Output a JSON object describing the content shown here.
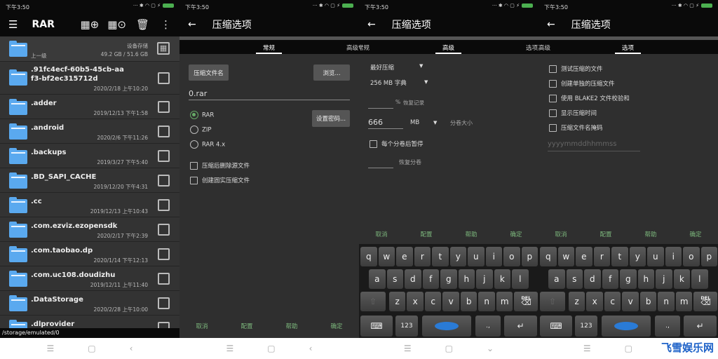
{
  "status": {
    "time": "下午3:50",
    "icons": [
      "dots-icon",
      "bluetooth-icon",
      "wifi-icon",
      "sim-icon",
      "charge-icon",
      "battery-icon"
    ]
  },
  "colors": {
    "accent": "#4caf50",
    "folder": "#5aa9ef",
    "footer_text": "#7cb77c"
  },
  "browser": {
    "title": "RAR",
    "toolbar_icons": [
      "add-to-archive-icon",
      "extract-icon",
      "trash-icon",
      "more-icon"
    ],
    "parent": {
      "label": "上一级",
      "storage_name": "设备存储",
      "storage_size": "49.2 GB / 51.6 GB"
    },
    "items": [
      {
        "name": ".91fc4ecf-60b5-45cb-aaf3-bf2ec315712d",
        "date": "2020/2/18 上午10:20"
      },
      {
        "name": ".adder",
        "date": "2019/12/13 下午1:58"
      },
      {
        "name": ".android",
        "date": "2020/2/6 下午11:26"
      },
      {
        "name": ".backups",
        "date": "2019/3/27 下午5:40"
      },
      {
        "name": ".BD_SAPI_CACHE",
        "date": "2019/12/20 下午4:31"
      },
      {
        "name": ".cc",
        "date": "2019/12/13 上午10:43"
      },
      {
        "name": ".com.ezviz.ezopensdk",
        "date": "2020/2/17 下午2:39"
      },
      {
        "name": ".com.taobao.dp",
        "date": "2020/1/14 下午12:13"
      },
      {
        "name": ".com.uc108.doudizhu",
        "date": "2019/12/11 上午11:40"
      },
      {
        "name": ".DataStorage",
        "date": "2020/2/28 上午10:00"
      },
      {
        "name": ".dlprovider",
        "date": ""
      }
    ],
    "path": "/storage/emulated/0"
  },
  "options": {
    "title": "压缩选项",
    "footer": [
      "取消",
      "配置",
      "帮助",
      "确定"
    ],
    "general": {
      "tabs": [
        "常规",
        "高级常规"
      ],
      "archive_name_button": "压缩文件名",
      "browse_button": "浏览...",
      "archive_name": "0.rar",
      "password_button": "设置密码...",
      "formats": [
        {
          "label": "RAR",
          "selected": true
        },
        {
          "label": "ZIP",
          "selected": false
        },
        {
          "label": "RAR 4.x",
          "selected": false
        }
      ],
      "checks": [
        {
          "label": "压缩后删除源文件",
          "checked": false
        },
        {
          "label": "创建固实压缩文件",
          "checked": false
        }
      ]
    },
    "advanced": {
      "tabs": [
        "常规",
        "高级",
        "选项高级"
      ],
      "method": "最好压缩",
      "dictionary": "256 MB 字典",
      "recovery_unit": "%",
      "recovery_label": "恢复记录",
      "recovery_value": "",
      "volume_value": "666",
      "volume_unit": "MB",
      "volume_label": "分卷大小",
      "pause_label": "每个分卷后暂停",
      "pause_checked": false,
      "recover_volumes_label": "恢复分卷"
    },
    "extra": {
      "tabs": [
        "高级",
        "选项"
      ],
      "checks": [
        {
          "label": "测试压缩的文件",
          "checked": false
        },
        {
          "label": "创建单独的压缩文件",
          "checked": false
        },
        {
          "label": "使用 BLAKE2 文件校验和",
          "checked": false
        },
        {
          "label": "显示压缩时间",
          "checked": false
        },
        {
          "label": "压缩文件名掩码",
          "checked": false
        }
      ],
      "mask_placeholder": "yyyymmddhhmmss"
    }
  },
  "keyboard": {
    "rows": [
      [
        "q",
        "w",
        "e",
        "r",
        "t",
        "y",
        "u",
        "i",
        "o",
        "p"
      ],
      [
        "a",
        "s",
        "d",
        "f",
        "g",
        "h",
        "j",
        "k",
        "l"
      ],
      [
        "shift",
        "z",
        "x",
        "c",
        "v",
        "b",
        "n",
        "m",
        "DEL"
      ]
    ],
    "bottom": [
      "keyboard",
      "123",
      "space",
      "., ",
      "enter"
    ]
  },
  "nav": [
    "menu-icon",
    "home-icon",
    "back-icon"
  ],
  "watermark": "飞雪娱乐网"
}
